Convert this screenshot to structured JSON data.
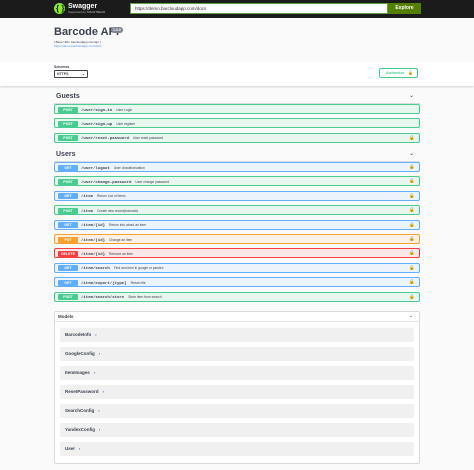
{
  "topbar": {
    "logo_text": "Swagger",
    "logo_sub": "Supported by SMARTBEAR",
    "url": "https://demo.barcloudapp.com/docs",
    "explore_label": "Explore"
  },
  "info": {
    "title": "Barcode API",
    "version": "1.0.0",
    "base_url": "[ Base URL: barcloudapp.com/api ]",
    "spec_link": "https://demo.barcloudapp.com/docs"
  },
  "schemes": {
    "label": "Schemes",
    "selected": "HTTPS",
    "authorize_label": "Authorize"
  },
  "tags": [
    {
      "name": "Guests",
      "operations": [
        {
          "method": "POST",
          "path": "/user/sign-in",
          "summary": "User Login",
          "locked": false
        },
        {
          "method": "POST",
          "path": "/user/sign-up",
          "summary": "User register",
          "locked": false
        },
        {
          "method": "POST",
          "path": "/user/reset-password",
          "summary": "User reset password",
          "locked": true
        }
      ]
    },
    {
      "name": "Users",
      "operations": [
        {
          "method": "GET",
          "path": "/user/logout",
          "summary": "User Unauthorization",
          "locked": true
        },
        {
          "method": "POST",
          "path": "/user/change-password",
          "summary": "User change password",
          "locked": true
        },
        {
          "method": "GET",
          "path": "/item",
          "summary": "Return List of Items",
          "locked": true
        },
        {
          "method": "POST",
          "path": "/item",
          "summary": "Create new record(barcode)",
          "locked": true
        },
        {
          "method": "GET",
          "path": "/item/{id}",
          "summary": "Return info about an item",
          "locked": true
        },
        {
          "method": "PUT",
          "path": "/item/{id}",
          "summary": "Change an item",
          "locked": true
        },
        {
          "method": "DELETE",
          "path": "/item/{id}",
          "summary": "Remove an item",
          "locked": true
        },
        {
          "method": "GET",
          "path": "/item/search",
          "summary": "Find and item in google or yandex",
          "locked": true
        },
        {
          "method": "GET",
          "path": "/item/export/{type}",
          "summary": "Return file",
          "locked": true
        },
        {
          "method": "POST",
          "path": "/item/search/store",
          "summary": "Store item from search",
          "locked": true
        }
      ]
    }
  ],
  "models": {
    "title": "Models",
    "items": [
      "BarcodeInfo",
      "GoogleConfig",
      "ItemImages",
      "ResetPassword",
      "SearchConfig",
      "YandexConfig",
      "User"
    ]
  },
  "colors": {
    "post": "#49cc90",
    "get": "#61affe",
    "put": "#fca130",
    "delete": "#f93e3e",
    "topbar": "#1b1b1b",
    "explore": "#547f00"
  },
  "icons": {
    "lock": "lock-icon",
    "chevron": "chevron-down-icon",
    "arrow": "chevron-right-icon"
  }
}
